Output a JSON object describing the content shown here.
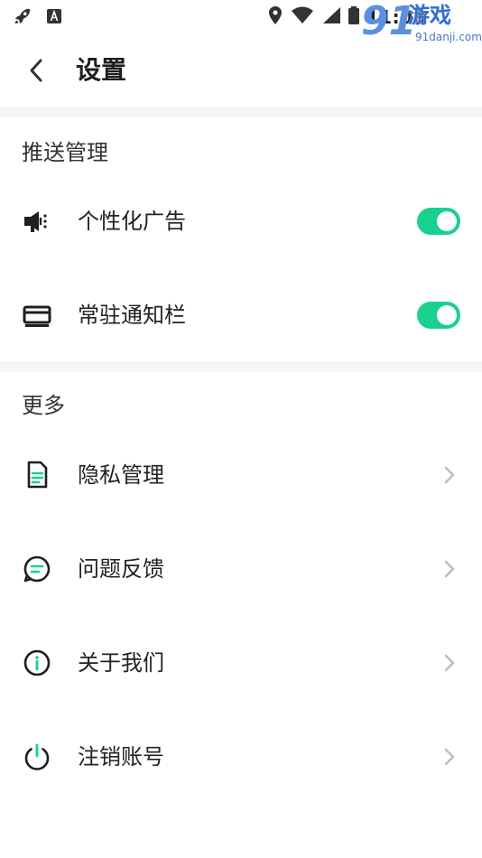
{
  "status_bar": {
    "time": "11:08",
    "icons": [
      "rocket-icon",
      "font-a-icon",
      "location-icon",
      "wifi-icon",
      "signal-icon",
      "battery-icon"
    ]
  },
  "watermark": {
    "number": "91",
    "brand": "游戏",
    "url": "91danji.com"
  },
  "nav": {
    "title": "设置",
    "back_icon": "chevron-left-icon"
  },
  "colors": {
    "accent": "#19d18f",
    "band": "#f4f6f8",
    "text": "#222222",
    "chevron": "#b8bec6"
  },
  "sections": [
    {
      "title": "推送管理",
      "items": [
        {
          "label": "个性化广告",
          "icon": "megaphone-icon",
          "control": "toggle",
          "on": true
        },
        {
          "label": "常驻通知栏",
          "icon": "wallet-icon",
          "control": "toggle",
          "on": true
        }
      ]
    },
    {
      "title": "更多",
      "items": [
        {
          "label": "隐私管理",
          "icon": "document-icon",
          "control": "chevron"
        },
        {
          "label": "问题反馈",
          "icon": "chat-bubble-icon",
          "control": "chevron"
        },
        {
          "label": "关于我们",
          "icon": "info-icon",
          "control": "chevron"
        },
        {
          "label": "注销账号",
          "icon": "power-icon",
          "control": "chevron"
        }
      ]
    }
  ]
}
